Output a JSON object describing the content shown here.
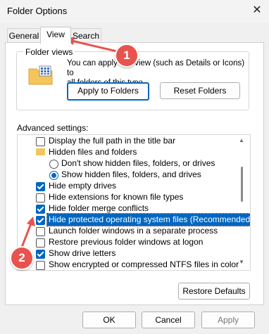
{
  "window": {
    "title": "Folder Options",
    "close": "✕"
  },
  "tabs": [
    {
      "label": "General"
    },
    {
      "label": "View"
    },
    {
      "label": "Search"
    }
  ],
  "folder_views": {
    "group_label": "Folder views",
    "description_line1": "You can apply this view (such as Details or Icons) to",
    "description_line2": "all folders of this type.",
    "apply_button": "Apply to Folders",
    "reset_button": "Reset Folders"
  },
  "advanced": {
    "label": "Advanced settings:",
    "items": [
      {
        "label": "Display the full path in the title bar",
        "type": "checkbox",
        "checked": false
      },
      {
        "label": "Hidden files and folders",
        "type": "folder"
      },
      {
        "label": "Don't show hidden files, folders, or drives",
        "type": "radio",
        "checked": false
      },
      {
        "label": "Show hidden files, folders, and drives",
        "type": "radio",
        "checked": true
      },
      {
        "label": "Hide empty drives",
        "type": "checkbox",
        "checked": true
      },
      {
        "label": "Hide extensions for known file types",
        "type": "checkbox",
        "checked": false
      },
      {
        "label": "Hide folder merge conflicts",
        "type": "checkbox",
        "checked": true
      },
      {
        "label": "Hide protected operating system files (Recommended)",
        "type": "checkbox",
        "checked": true,
        "selected": true
      },
      {
        "label": "Launch folder windows in a separate process",
        "type": "checkbox",
        "checked": false
      },
      {
        "label": "Restore previous folder windows at logon",
        "type": "checkbox",
        "checked": false
      },
      {
        "label": "Show drive letters",
        "type": "checkbox",
        "checked": true
      },
      {
        "label": "Show encrypted or compressed NTFS files in color",
        "type": "checkbox",
        "checked": false
      }
    ],
    "restore_button": "Restore Defaults"
  },
  "footer": {
    "ok": "OK",
    "cancel": "Cancel",
    "apply": "Apply"
  },
  "annotations": [
    {
      "number": "1"
    },
    {
      "number": "2"
    }
  ],
  "colors": {
    "accent": "#0067c0",
    "annotation": "#e8534e",
    "folder": "#f4c55b"
  }
}
